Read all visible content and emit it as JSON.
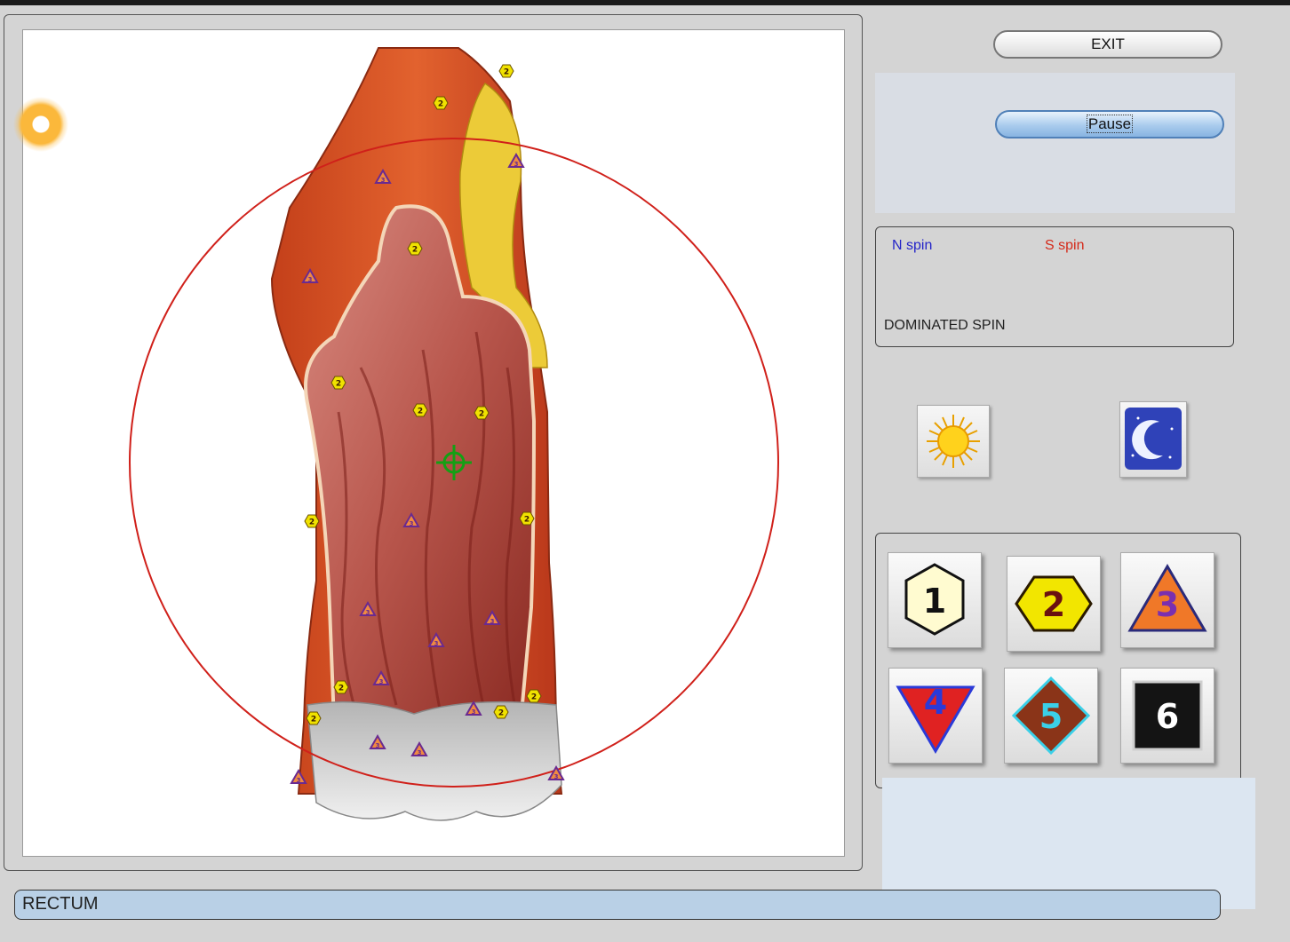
{
  "buttons": {
    "exit_label": "EXIT",
    "pause_label": "Pause"
  },
  "spin": {
    "n_label": "N spin",
    "s_label": "S spin",
    "dominated_label": "DOMINATED SPIN"
  },
  "levels": [
    {
      "label": "1",
      "shape": "hexagon",
      "fill": "#fffbd0",
      "text_color": "#111111"
    },
    {
      "label": "2",
      "shape": "wide-hexagon",
      "fill": "#f2e600",
      "text_color": "#6a1010"
    },
    {
      "label": "3",
      "shape": "triangle",
      "fill": "#f07828",
      "text_color": "#7a2fb0"
    },
    {
      "label": "4",
      "shape": "inverted-triangle",
      "fill": "#e02222",
      "text_color": "#2a3ad8"
    },
    {
      "label": "5",
      "shape": "diamond",
      "fill": "#8a3418",
      "text_color": "#3ad0e8"
    },
    {
      "label": "6",
      "shape": "square",
      "fill": "#141414",
      "text_color": "#ffffff"
    }
  ],
  "organ": {
    "name": "RECTUM"
  },
  "markers": {
    "hex_label": "2",
    "triangle_label": "3"
  },
  "colors": {
    "scan_circle": "#d0201a",
    "target": "#14a014",
    "hex_marker": "#f0e200",
    "tri_marker": "#6a2a90"
  }
}
